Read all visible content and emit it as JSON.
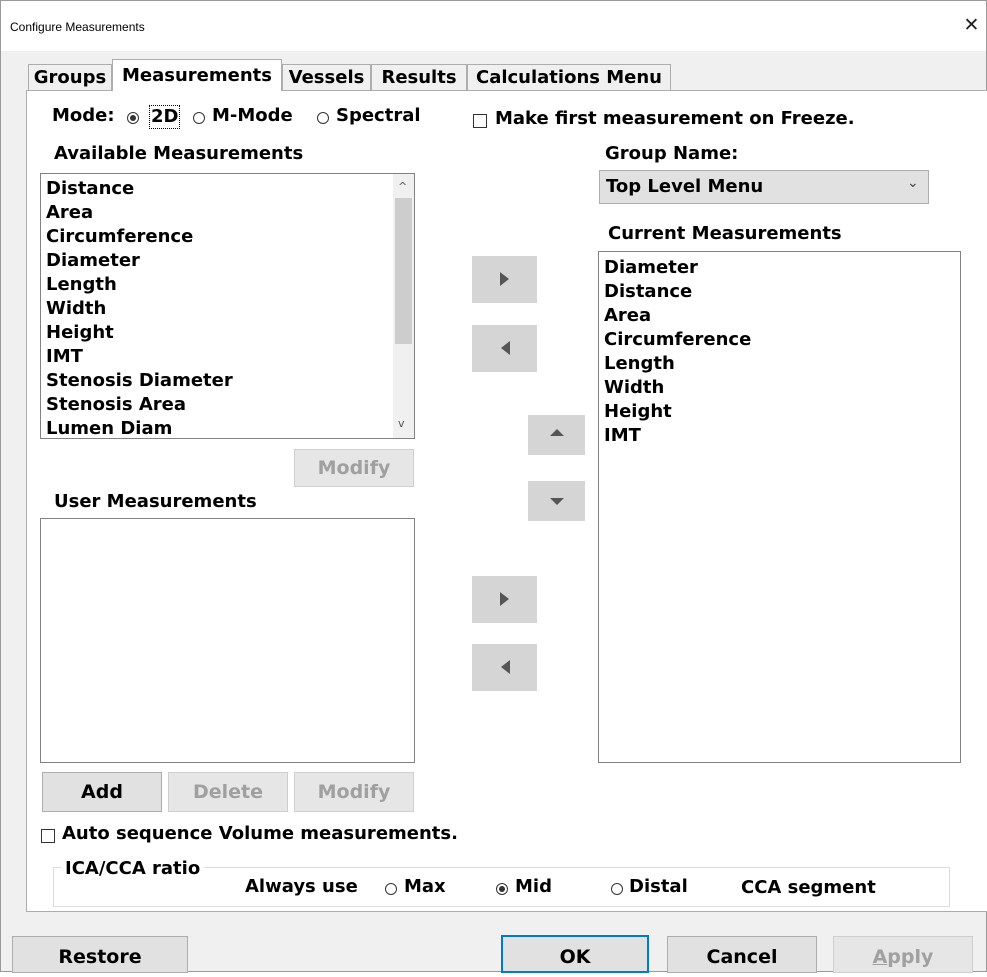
{
  "window": {
    "title": "Configure Measurements",
    "close_glyph": "✕"
  },
  "tabs": [
    {
      "label": "Groups",
      "active": false
    },
    {
      "label": "Measurements",
      "active": true
    },
    {
      "label": "Vessels",
      "active": false
    },
    {
      "label": "Results",
      "active": false
    },
    {
      "label": "Calculations Menu",
      "active": false
    }
  ],
  "mode": {
    "label": "Mode:",
    "options": [
      {
        "label": "2D",
        "selected": true
      },
      {
        "label": "M-Mode",
        "selected": false
      },
      {
        "label": "Spectral",
        "selected": false
      }
    ]
  },
  "freeze_checkbox": {
    "label": "Make first measurement on Freeze.",
    "checked": false
  },
  "available": {
    "title": "Available Measurements",
    "items": [
      "Distance",
      "Area",
      "Circumference",
      "Diameter",
      "Length",
      "Width",
      "Height",
      "IMT",
      "Stenosis Diameter",
      "Stenosis Area",
      "Lumen  Diam"
    ],
    "modify_label": "Modify"
  },
  "group": {
    "label": "Group Name:",
    "selected": "Top Level Menu"
  },
  "current": {
    "title": "Current Measurements",
    "items": [
      "Diameter",
      "Distance",
      "Area",
      "Circumference",
      "Length",
      "Width",
      "Height",
      "IMT"
    ]
  },
  "user": {
    "title": "User Measurements",
    "items": [],
    "add_label": "Add",
    "delete_label": "Delete",
    "modify_label": "Modify"
  },
  "auto_sequence": {
    "label": "Auto sequence Volume measurements.",
    "checked": false
  },
  "ica_cca": {
    "group_label": "ICA/CCA ratio",
    "always_use": "Always use",
    "options": [
      {
        "label": "Max",
        "selected": false
      },
      {
        "label": "Mid",
        "selected": true
      },
      {
        "label": "Distal",
        "selected": false
      }
    ],
    "suffix": "CCA segment"
  },
  "footer": {
    "restore_label": "Restore",
    "ok_label": "OK",
    "cancel_label": "Cancel",
    "apply_label": "Apply",
    "apply_mnemonic": "A",
    "apply_rest": "pply"
  },
  "colors": {
    "ok_border": "#0078d7",
    "disabled_text": "#a0a0a0",
    "arrow_button": "#d5d5d5"
  }
}
